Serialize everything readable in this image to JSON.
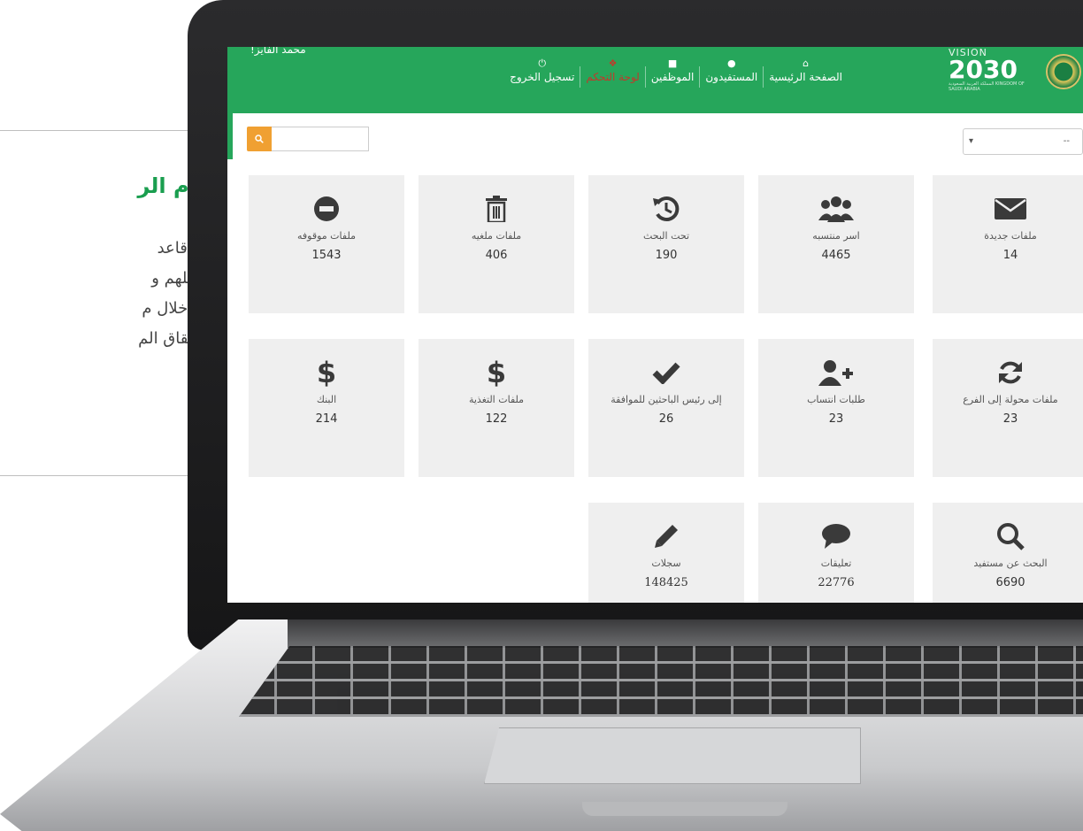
{
  "promo": {
    "title": "نظام الر",
    "lines": [
      "وفيه قاعد",
      "تسجيلهم و",
      "ومن خلال م",
      "استحقاق الم"
    ]
  },
  "nav": {
    "user_name": "محمد الفايز!",
    "vision": {
      "word": "VISION",
      "year": "2030",
      "sub": "المملكة العربية السعودية KINGDOM OF SAUDI ARABIA"
    },
    "items": [
      {
        "label": "الصفحة الرئيسية",
        "icon": "home-icon"
      },
      {
        "label": "المستفيدون",
        "icon": "users-icon"
      },
      {
        "label": "الموظفين",
        "icon": "user-icon"
      },
      {
        "label": "لوحة التحكم",
        "icon": "dashboard-icon",
        "active": true
      },
      {
        "label": "تسجيل الخروج",
        "icon": "power-icon"
      }
    ]
  },
  "filter": {
    "selected": "--"
  },
  "search": {
    "placeholder": "",
    "value": ""
  },
  "cards": [
    {
      "label": "ملفات جديدة",
      "count": "14",
      "icon": "envelope-icon"
    },
    {
      "label": "اسر منتسبه",
      "count": "4465",
      "icon": "users-group-icon"
    },
    {
      "label": "تحت البحث",
      "count": "190",
      "icon": "history-icon"
    },
    {
      "label": "ملفات ملغيه",
      "count": "406",
      "icon": "trash-icon"
    },
    {
      "label": "ملفات موقوفه",
      "count": "1543",
      "icon": "minus-circle-icon"
    },
    {
      "label": "ملفات محولة إلى الفرع",
      "count": "23",
      "icon": "refresh-icon"
    },
    {
      "label": "طلبات انتساب",
      "count": "23",
      "icon": "user-plus-icon"
    },
    {
      "label": "إلى رئيس الباحثين للموافقة",
      "count": "26",
      "icon": "check-icon"
    },
    {
      "label": "ملفات التغذية",
      "count": "122",
      "icon": "dollar-icon"
    },
    {
      "label": "البنك",
      "count": "214",
      "icon": "dollar-icon"
    },
    {
      "label": "البحث عن مستفيد",
      "count": "6690",
      "icon": "search-icon"
    },
    {
      "label": "تعليقات",
      "count": "22776",
      "icon": "comment-icon"
    },
    {
      "label": "سجلات",
      "count": "148425",
      "icon": "pencil-icon"
    }
  ],
  "colors": {
    "brand_green": "#26a65b",
    "search_orange": "#f0a032",
    "card_bg": "#efefef",
    "active_nav": "#c0392b"
  }
}
